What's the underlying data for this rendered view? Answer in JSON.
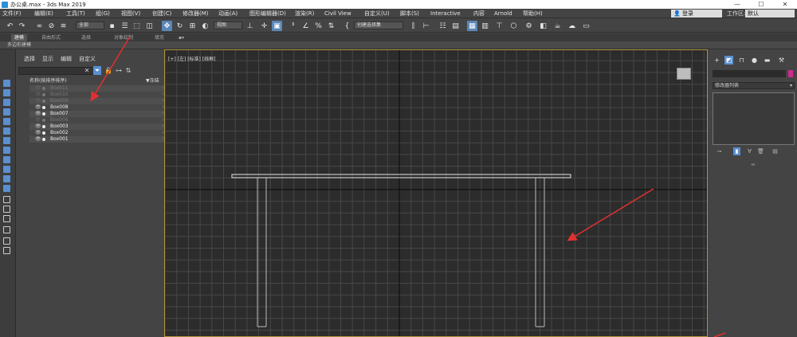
{
  "window": {
    "title": "办公桌.max - 3ds Max 2019",
    "controls": [
      "—",
      "☐",
      "✕"
    ]
  },
  "menu": {
    "items": [
      "文件(F)",
      "编辑(E)",
      "工具(T)",
      "组(G)",
      "视图(V)",
      "创建(C)",
      "修改器(M)",
      "动画(A)",
      "图形编辑器(D)",
      "渲染(R)",
      "Civil View",
      "自定义(U)",
      "脚本(S)",
      "Interactive",
      "内容",
      "Arnold",
      "帮助(H)"
    ],
    "login": "登录",
    "workspace_label": "工作区:",
    "workspace_value": "默认"
  },
  "toolbar": {
    "filter_value": "全部",
    "coord_value": "视图",
    "selection_set_value": "创建选择集"
  },
  "ribbon": {
    "tabs": [
      "建模",
      "自由形式",
      "选择",
      "对象绘制",
      "填充"
    ],
    "active_tab": "建模",
    "subtitle": "多边形建模"
  },
  "explorer": {
    "menu": [
      "选择",
      "显示",
      "编辑",
      "自定义"
    ],
    "column_name": "名称(按排序排序)",
    "column_freeze": "▼冻结",
    "rows": [
      {
        "name": "Box011",
        "visible": false
      },
      {
        "name": "Box010",
        "visible": false
      },
      {
        "name": "Box009",
        "visible": false
      },
      {
        "name": "Box008",
        "visible": true
      },
      {
        "name": "Box007",
        "visible": true
      },
      {
        "name": "Box006",
        "visible": false
      },
      {
        "name": "Box003",
        "visible": true
      },
      {
        "name": "Box002",
        "visible": true
      },
      {
        "name": "Box001",
        "visible": true
      }
    ]
  },
  "viewport": {
    "label": "[+] [左] [标准] [线框]",
    "frame_color": "#b0943a"
  },
  "command_panel": {
    "modifier_list": "修改器列表",
    "object_color": "#cf2a8f"
  },
  "annotations": {
    "arrow_color": "#e03030"
  }
}
